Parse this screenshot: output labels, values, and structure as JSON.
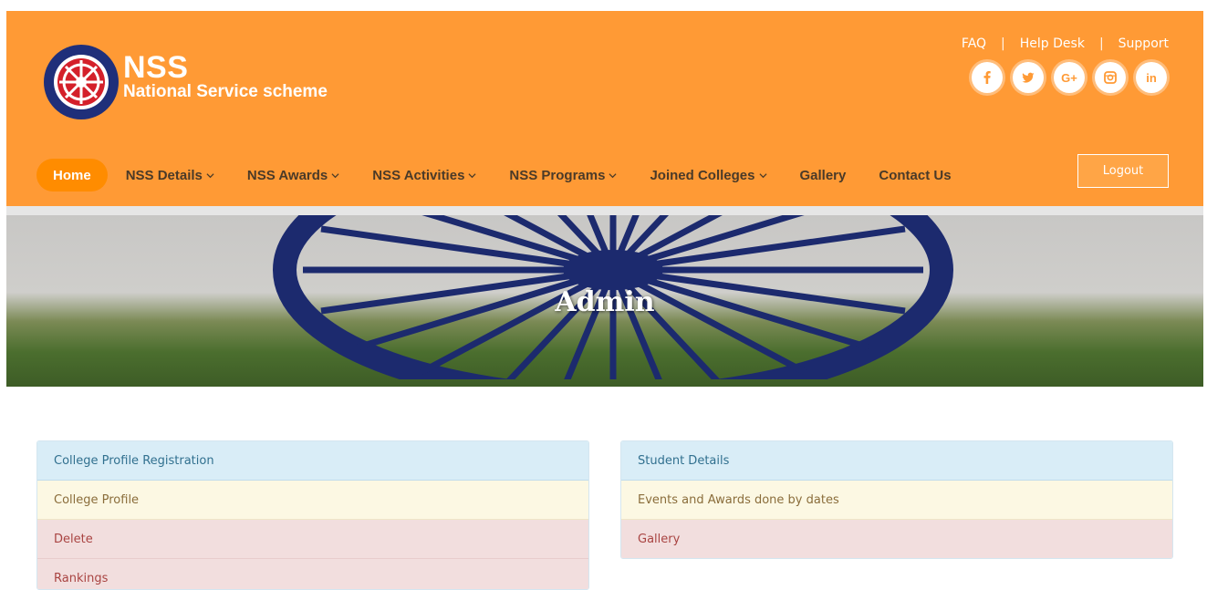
{
  "brand": {
    "title": "NSS",
    "subtitle": "National Service scheme",
    "logo_icon": "nss-wheel-logo",
    "accent_color": "#ff9a35"
  },
  "top_links": [
    "FAQ",
    "Help Desk",
    "Support"
  ],
  "social": [
    {
      "icon": "facebook-icon",
      "glyph": "f"
    },
    {
      "icon": "twitter-icon",
      "glyph": "t"
    },
    {
      "icon": "google-plus-icon",
      "glyph": "G+"
    },
    {
      "icon": "instagram-icon",
      "glyph": "ig"
    },
    {
      "icon": "linkedin-icon",
      "glyph": "in"
    }
  ],
  "nav": {
    "items": [
      {
        "label": "Home"
      },
      {
        "label": "NSS Details"
      },
      {
        "label": "NSS Awards"
      },
      {
        "label": "NSS Activities"
      },
      {
        "label": "NSS Programs"
      },
      {
        "label": "Joined Colleges"
      },
      {
        "label": "Gallery"
      },
      {
        "label": "Contact Us"
      }
    ],
    "logout_label": "Logout"
  },
  "hero": {
    "title": "Admin"
  },
  "left_panel": {
    "items": [
      {
        "label": "College Profile Registration"
      },
      {
        "label": "College Profile"
      },
      {
        "label": "Delete"
      },
      {
        "label": "Rankings"
      }
    ]
  },
  "right_panel": {
    "items": [
      {
        "label": "Student Details"
      },
      {
        "label": "Events and Awards done by dates"
      },
      {
        "label": "Gallery"
      }
    ]
  }
}
